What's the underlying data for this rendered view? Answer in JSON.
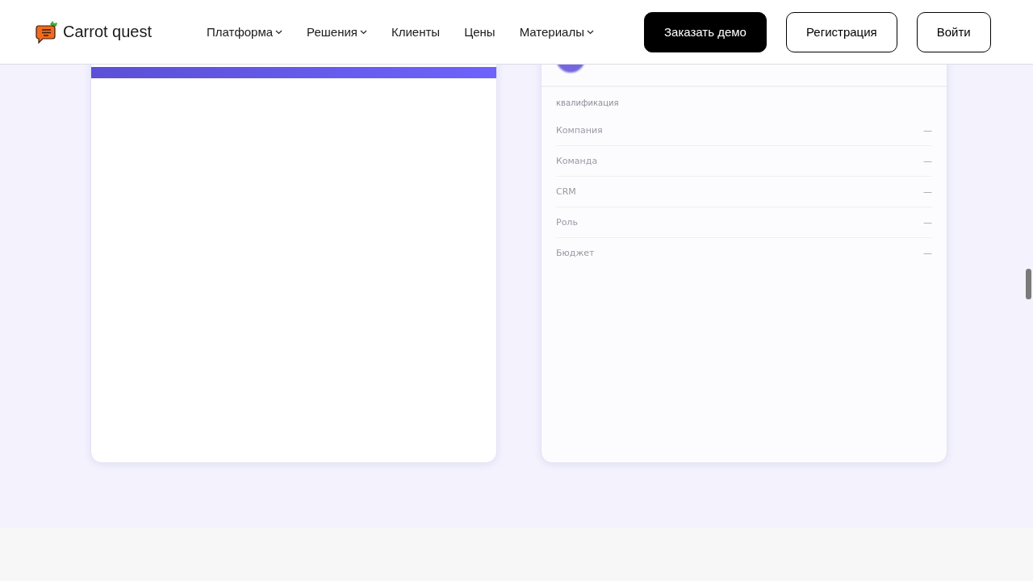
{
  "header": {
    "logo": "Carrot quest",
    "nav": [
      {
        "label": "Платформа",
        "dropdown": true
      },
      {
        "label": "Решения",
        "dropdown": true
      },
      {
        "label": "Клиенты",
        "dropdown": false
      },
      {
        "label": "Цены",
        "dropdown": false
      },
      {
        "label": "Материалы",
        "dropdown": true
      }
    ],
    "buttons": [
      {
        "label": "Заказать демо",
        "kind": "primary"
      },
      {
        "label": "Регистрация",
        "kind": "outline"
      },
      {
        "label": "Войти",
        "kind": "outline"
      }
    ]
  },
  "profile_card": {
    "section": "квалификация",
    "rows": [
      {
        "label": "Компания",
        "value": "—"
      },
      {
        "label": "Команда",
        "value": "—"
      },
      {
        "label": "CRM",
        "value": "—"
      },
      {
        "label": "Роль",
        "value": "—"
      },
      {
        "label": "Бюджет",
        "value": "—"
      }
    ]
  }
}
